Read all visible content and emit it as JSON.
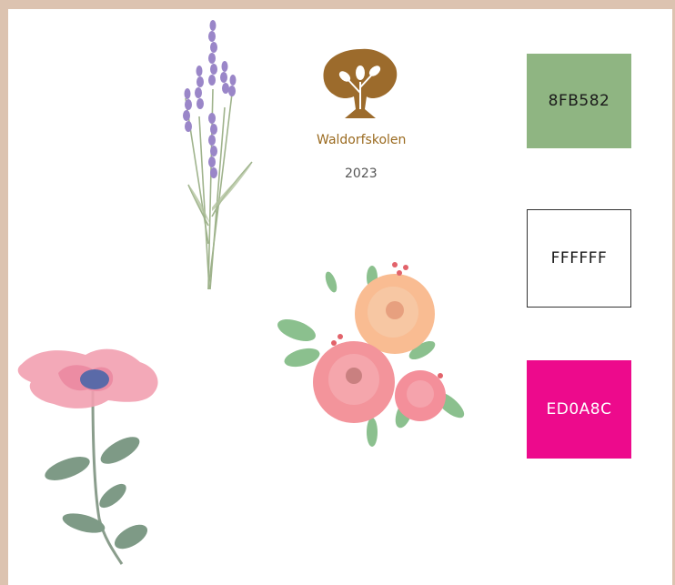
{
  "brand": {
    "logo_icon": "tree-logo-icon",
    "name": "Waldorfskolen",
    "year": "2023"
  },
  "swatches": [
    {
      "label": "8FB582",
      "color": "#8FB582",
      "text_color": "#1a1a1a"
    },
    {
      "label": "FFFFFF",
      "color": "#FFFFFF",
      "text_color": "#1a1a1a"
    },
    {
      "label": "ED0A8C",
      "color": "#ED0A8C",
      "text_color": "#ffffff"
    }
  ],
  "illustrations": [
    "lavender-illustration",
    "rose-bouquet-illustration",
    "pink-flower-illustration"
  ]
}
